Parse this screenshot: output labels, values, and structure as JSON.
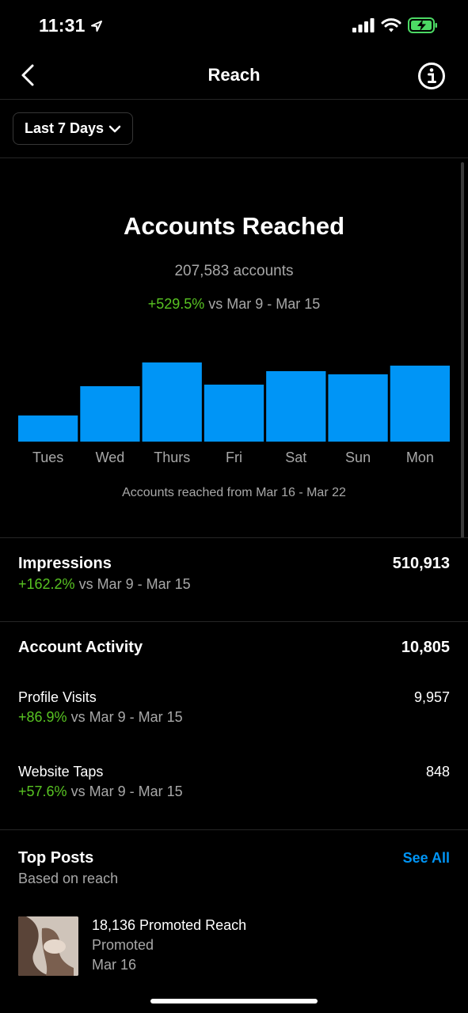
{
  "status_bar": {
    "time": "11:31",
    "location_icon": "location-arrow-icon",
    "battery_color": "#4cd964"
  },
  "nav": {
    "title": "Reach",
    "back_icon": "chevron-left-icon",
    "info_icon": "info-circle-icon"
  },
  "date_range": {
    "label": "Last 7 Days",
    "icon": "chevron-down-icon"
  },
  "reach": {
    "title": "Accounts Reached",
    "count": "207,583 accounts",
    "delta": "+529.5%",
    "delta_suffix": " vs Mar 9 - Mar 15",
    "caption": "Accounts reached from Mar 16 - Mar 22"
  },
  "chart_data": {
    "type": "bar",
    "categories": [
      "Tues",
      "Wed",
      "Thurs",
      "Fri",
      "Sat",
      "Sun",
      "Mon"
    ],
    "values": [
      33,
      70,
      100,
      72,
      89,
      85,
      96
    ],
    "value_units": "relative bar height (0-100, no axis printed)",
    "ylim": [
      0,
      100
    ],
    "bar_color": "#0095f6",
    "grid": false,
    "legend": "none"
  },
  "impressions": {
    "label": "Impressions",
    "value": "510,913",
    "delta": "+162.2%",
    "delta_suffix": " vs Mar 9 - Mar 15"
  },
  "account_activity": {
    "label": "Account Activity",
    "value": "10,805",
    "items": [
      {
        "label": "Profile Visits",
        "value": "9,957",
        "delta": "+86.9%",
        "delta_suffix": " vs Mar 9 - Mar 15"
      },
      {
        "label": "Website Taps",
        "value": "848",
        "delta": "+57.6%",
        "delta_suffix": " vs Mar 9 - Mar 15"
      }
    ]
  },
  "top_posts": {
    "title": "Top Posts",
    "subtitle": "Based on reach",
    "see_all": "See All",
    "posts": [
      {
        "title": "18,136 Promoted Reach",
        "type": "Promoted",
        "date": "Mar 16"
      }
    ]
  },
  "colors": {
    "accent": "#0095f6",
    "positive": "#58c322",
    "muted_text": "#a8a8a8",
    "divider": "#262626"
  }
}
